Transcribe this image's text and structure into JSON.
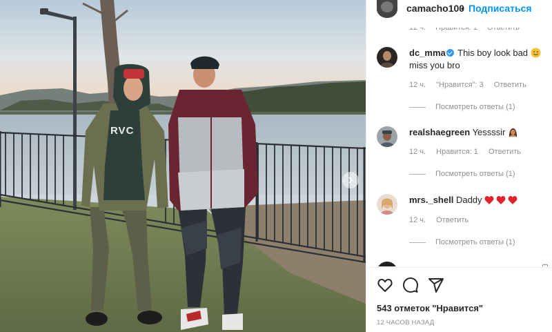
{
  "header": {
    "username": "camacho100",
    "separator": "•",
    "follow_label": "Подписаться"
  },
  "partial_comment": {
    "time": "12 ч.",
    "likes": "Нравится: 1",
    "reply": "Ответить"
  },
  "comments": [
    {
      "user": "dc_mma",
      "verified": true,
      "text": "This boy look bad",
      "text_line2": "miss you bro",
      "emoji": "smiling-face-icon",
      "time": "12 ч.",
      "likes": "\"Нравится\": 3",
      "reply": "Ответить",
      "view_replies": "Посмотреть ответы (1)"
    },
    {
      "user": "realshaegreen",
      "verified": false,
      "text": "Yessssir",
      "emoji": "person-emoji-icon",
      "time": "12 ч.",
      "likes": "Нравится: 1",
      "reply": "Ответить",
      "view_replies": "Посмотреть ответы (1)"
    },
    {
      "user": "mrs._shell",
      "verified": false,
      "text": "Daddy",
      "emoji": "red-heart-icon",
      "time": "12 ч.",
      "reply": "Ответить",
      "view_replies": "Посмотреть ответы (1)"
    }
  ],
  "photo": {
    "hoodie_text": "RVC"
  },
  "actions": {
    "likes_text": "543 отметок \"Нравится\"",
    "time_ago": "12 ЧАСОВ НАЗАД"
  },
  "colors": {
    "accent": "#0095f6",
    "text": "#262626",
    "muted": "#8e8e8e",
    "verified": "#3897f0",
    "heart": "#ed4956"
  }
}
